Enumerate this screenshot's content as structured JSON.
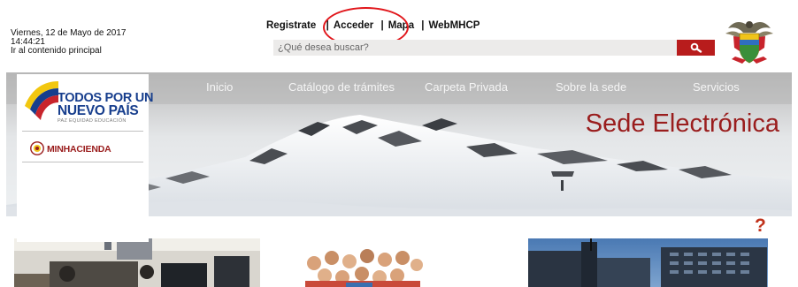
{
  "header": {
    "date": "Viernes, 12 de Mayo de 2017",
    "time": "14:44:21",
    "skip_link": "Ir al contenido principal"
  },
  "top_links": [
    {
      "label": "Registrate"
    },
    {
      "label": "Acceder"
    },
    {
      "label": "Mapa"
    },
    {
      "label": "WebMHCP"
    }
  ],
  "search": {
    "placeholder": "¿Qué desea buscar?",
    "button_icon": "search-icon"
  },
  "nav": {
    "items": [
      "Inicio",
      "Catálogo de trámites",
      "Carpeta Privada",
      "Sobre la sede",
      "Servicios"
    ]
  },
  "banner": {
    "title": "Sede Electrónica"
  },
  "logo": {
    "line1": "TODOS POR UN",
    "line2": "NUEVO PAÍS",
    "sub": "PAZ  EQUIDAD  EDUCACIÓN",
    "ministry": "MINHACIENDA"
  },
  "help": {
    "label": "?"
  },
  "colors": {
    "accent": "#b81c1c",
    "title": "#9a1d1d",
    "logo_blue": "#173e8d",
    "highlight": "#e1161b"
  }
}
